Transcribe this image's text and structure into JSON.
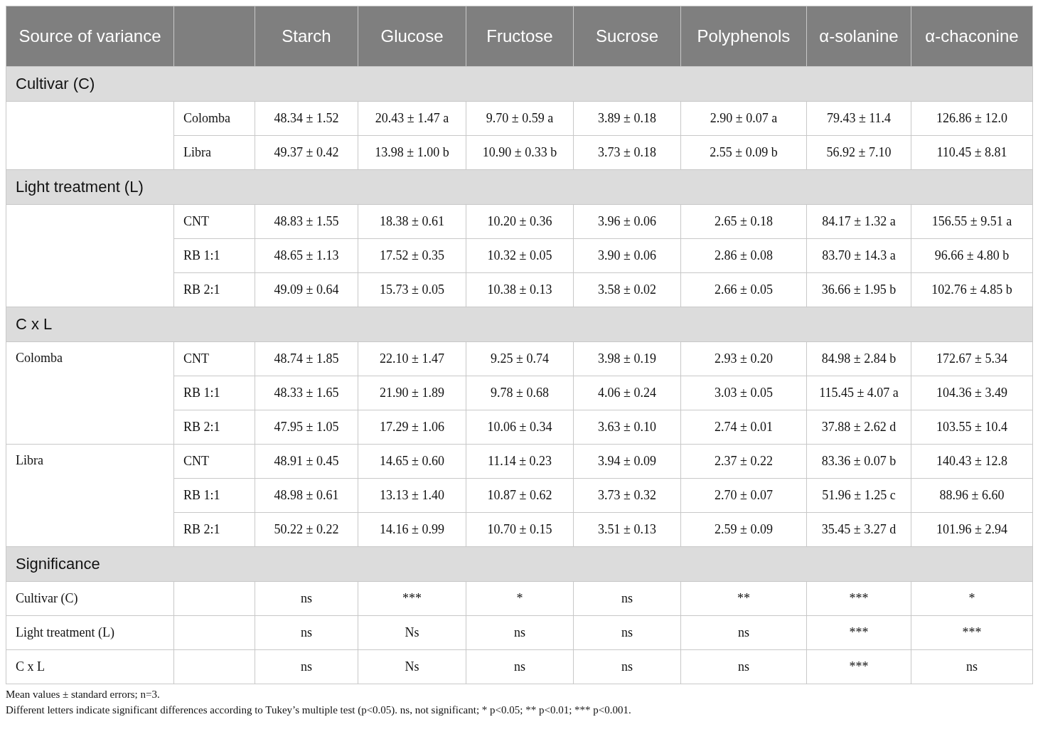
{
  "table": {
    "columns": [
      "Source of variance",
      "Starch",
      "Glucose",
      "Fructose",
      "Sucrose",
      "Polyphenols",
      "α-solanine",
      "α-chaconine"
    ],
    "sections": [
      {
        "title": "Cultivar (C)",
        "groups": [
          {
            "rows": [
              {
                "treatment": "Colomba",
                "values": [
                  "48.34 ± 1.52",
                  "20.43 ± 1.47 a",
                  "9.70 ± 0.59 a",
                  "3.89 ± 0.18",
                  "2.90 ± 0.07 a",
                  "79.43 ± 11.4",
                  "126.86 ± 12.0"
                ]
              },
              {
                "treatment": "Libra",
                "values": [
                  "49.37 ± 0.42",
                  "13.98 ± 1.00 b",
                  "10.90 ± 0.33 b",
                  "3.73 ± 0.18",
                  "2.55 ± 0.09 b",
                  "56.92 ± 7.10",
                  "110.45 ± 8.81"
                ]
              }
            ]
          }
        ]
      },
      {
        "title": "Light treatment (L)",
        "groups": [
          {
            "rows": [
              {
                "treatment": "CNT",
                "values": [
                  "48.83 ± 1.55",
                  "18.38 ± 0.61",
                  "10.20 ± 0.36",
                  "3.96 ± 0.06",
                  "2.65 ± 0.18",
                  "84.17 ± 1.32 a",
                  "156.55 ± 9.51 a"
                ]
              },
              {
                "treatment": "RB 1:1",
                "values": [
                  "48.65 ± 1.13",
                  "17.52 ± 0.35",
                  "10.32 ± 0.05",
                  "3.90 ± 0.06",
                  "2.86 ± 0.08",
                  "83.70 ± 14.3 a",
                  "96.66 ± 4.80 b"
                ]
              },
              {
                "treatment": "RB 2:1",
                "values": [
                  "49.09 ± 0.64",
                  "15.73 ± 0.05",
                  "10.38 ± 0.13",
                  "3.58 ± 0.02",
                  "2.66 ± 0.05",
                  "36.66 ± 1.95 b",
                  "102.76 ± 4.85 b"
                ]
              }
            ]
          }
        ]
      },
      {
        "title": "C x L",
        "groups": [
          {
            "label": "Colomba",
            "rows": [
              {
                "treatment": "CNT",
                "values": [
                  "48.74 ± 1.85",
                  "22.10 ± 1.47",
                  "9.25 ± 0.74",
                  "3.98 ± 0.19",
                  "2.93 ± 0.20",
                  "84.98 ± 2.84 b",
                  "172.67 ± 5.34"
                ]
              },
              {
                "treatment": "RB 1:1",
                "values": [
                  "48.33 ± 1.65",
                  "21.90 ± 1.89",
                  "9.78 ± 0.68",
                  "4.06 ± 0.24",
                  "3.03 ± 0.05",
                  "115.45 ± 4.07 a",
                  "104.36 ± 3.49"
                ]
              },
              {
                "treatment": "RB 2:1",
                "values": [
                  "47.95 ± 1.05",
                  "17.29 ± 1.06",
                  "10.06 ± 0.34",
                  "3.63 ± 0.10",
                  "2.74 ± 0.01",
                  "37.88 ± 2.62 d",
                  "103.55 ± 10.4"
                ]
              }
            ]
          },
          {
            "label": "Libra",
            "rows": [
              {
                "treatment": "CNT",
                "values": [
                  "48.91 ± 0.45",
                  "14.65 ± 0.60",
                  "11.14 ± 0.23",
                  "3.94 ± 0.09",
                  "2.37 ± 0.22",
                  "83.36 ± 0.07 b",
                  "140.43 ± 12.8"
                ]
              },
              {
                "treatment": "RB 1:1",
                "values": [
                  "48.98 ± 0.61",
                  "13.13 ± 1.40",
                  "10.87 ± 0.62",
                  "3.73 ± 0.32",
                  "2.70 ± 0.07",
                  "51.96 ± 1.25 c",
                  "88.96 ± 6.60"
                ]
              },
              {
                "treatment": "RB 2:1",
                "values": [
                  "50.22 ± 0.22",
                  "14.16 ± 0.99",
                  "10.70 ± 0.15",
                  "3.51 ± 0.13",
                  "2.59 ± 0.09",
                  "35.45 ± 3.27 d",
                  "101.96 ± 2.94"
                ]
              }
            ]
          }
        ]
      },
      {
        "title": "Significance",
        "groups": [
          {
            "label": "Cultivar (C)",
            "rows": [
              {
                "values": [
                  "ns",
                  "***",
                  "*",
                  "ns",
                  "**",
                  "***",
                  "*"
                ]
              }
            ]
          },
          {
            "label": "Light treatment (L)",
            "rows": [
              {
                "values": [
                  "ns",
                  "Ns",
                  "ns",
                  "ns",
                  "ns",
                  "***",
                  "***"
                ]
              }
            ]
          },
          {
            "label": "C x L",
            "rows": [
              {
                "values": [
                  "ns",
                  "Ns",
                  "ns",
                  "ns",
                  "ns",
                  "***",
                  "ns"
                ]
              }
            ]
          }
        ]
      }
    ]
  },
  "footnotes": [
    "Mean values ± standard errors; n=3.",
    "Different letters indicate significant differences according to Tukey’s multiple test (p<0.05). ns, not significant; * p<0.05; ** p<0.01; *** p<0.001."
  ]
}
